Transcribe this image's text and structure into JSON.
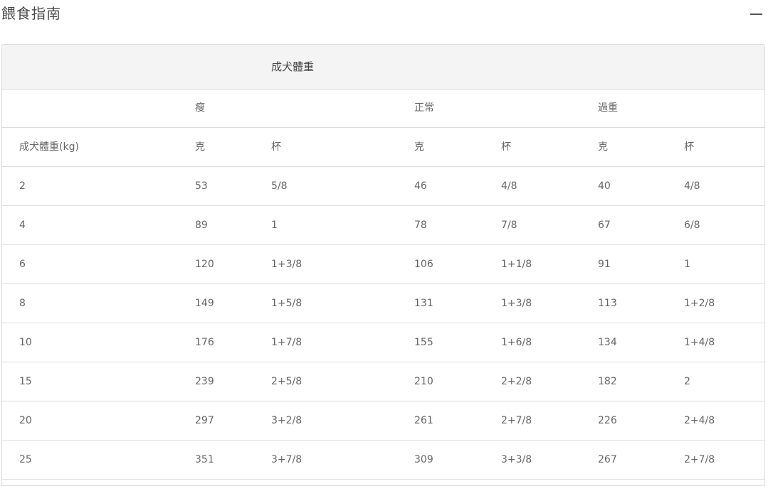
{
  "header": {
    "title": "餵食指南",
    "collapse_icon": "minus-icon"
  },
  "table": {
    "caption": "成犬體重",
    "groups": [
      "瘦",
      "正常",
      "過重"
    ],
    "columns": [
      "成犬體重(kg)",
      "克",
      "杯",
      "克",
      "杯",
      "克",
      "杯"
    ],
    "rows": [
      [
        "2",
        "53",
        "5/8",
        "46",
        "4/8",
        "40",
        "4/8"
      ],
      [
        "4",
        "89",
        "1",
        "78",
        "7/8",
        "67",
        "6/8"
      ],
      [
        "6",
        "120",
        "1+3/8",
        "106",
        "1+1/8",
        "91",
        "1"
      ],
      [
        "8",
        "149",
        "1+5/8",
        "131",
        "1+3/8",
        "113",
        "1+2/8"
      ],
      [
        "10",
        "176",
        "1+7/8",
        "155",
        "1+6/8",
        "134",
        "1+4/8"
      ],
      [
        "15",
        "239",
        "2+5/8",
        "210",
        "2+2/8",
        "182",
        "2"
      ],
      [
        "20",
        "297",
        "3+2/8",
        "261",
        "2+7/8",
        "226",
        "2+4/8"
      ],
      [
        "25",
        "351",
        "3+7/8",
        "309",
        "3+3/8",
        "267",
        "2+7/8"
      ]
    ]
  }
}
